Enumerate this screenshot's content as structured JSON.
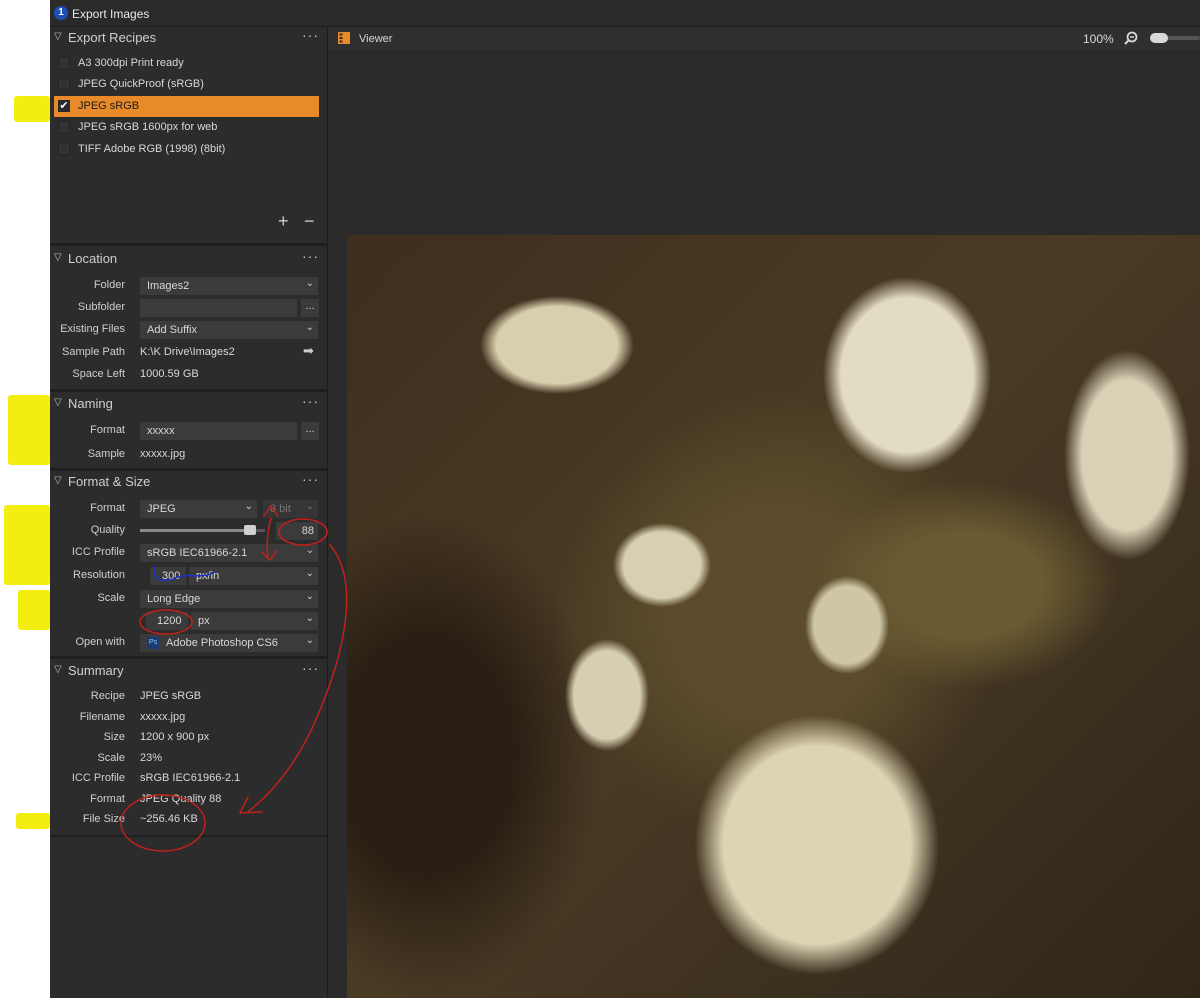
{
  "window": {
    "title": "Export Images",
    "app_icon": "1"
  },
  "recipes": {
    "title": "Export Recipes",
    "items": [
      {
        "label": "A3 300dpi Print ready",
        "checked": false
      },
      {
        "label": "JPEG QuickProof (sRGB)",
        "checked": false
      },
      {
        "label": "JPEG sRGB",
        "checked": true
      },
      {
        "label": "JPEG sRGB 1600px for web",
        "checked": false
      },
      {
        "label": "TIFF Adobe RGB (1998) (8bit)",
        "checked": false
      }
    ],
    "add_symbol": "+",
    "remove_symbol": "−"
  },
  "location": {
    "title": "Location",
    "folder_label": "Folder",
    "folder_value": "Images2",
    "subfolder_label": "Subfolder",
    "subfolder_value": "",
    "existing_label": "Existing Files",
    "existing_value": "Add Suffix",
    "sample_path_label": "Sample Path",
    "sample_path_value": "K:\\K Drive\\Images2",
    "space_left_label": "Space Left",
    "space_left_value": "1000.59 GB"
  },
  "naming": {
    "title": "Naming",
    "format_label": "Format",
    "format_value": "xxxxx",
    "sample_label": "Sample",
    "sample_value": "xxxxx.jpg"
  },
  "format_size": {
    "title": "Format & Size",
    "format_label": "Format",
    "format_value": "JPEG",
    "bit_value": "8 bit",
    "quality_label": "Quality",
    "quality_value": "88",
    "quality_fraction": 0.88,
    "icc_label": "ICC Profile",
    "icc_value": "sRGB IEC61966-2.1",
    "resolution_label": "Resolution",
    "resolution_value": "300",
    "resolution_unit": "px/in",
    "scale_label": "Scale",
    "scale_value": "Long Edge",
    "size_value": "1200",
    "size_unit": "px",
    "open_with_label": "Open with",
    "open_with_value": "Adobe Photoshop CS6",
    "open_with_icon": "Ps"
  },
  "summary": {
    "title": "Summary",
    "rows": [
      {
        "label": "Recipe",
        "value": "JPEG sRGB"
      },
      {
        "label": "Filename",
        "value": "xxxxx.jpg"
      },
      {
        "label": "Size",
        "value": "1200 x 900 px"
      },
      {
        "label": "Scale",
        "value": "23%"
      },
      {
        "label": "ICC Profile",
        "value": "sRGB IEC61966-2.1"
      },
      {
        "label": "Format",
        "value": "JPEG Quality 88"
      },
      {
        "label": "File Size",
        "value": "~256.46 KB"
      }
    ]
  },
  "viewer": {
    "title": "Viewer",
    "zoom": "100%"
  },
  "colors": {
    "accent": "#e98a2a",
    "panel_bg": "#2c2c2c",
    "annotation_red": "#c0211b",
    "annotation_blue": "#1d33c9",
    "highlight_yellow": "#f3ee10"
  }
}
